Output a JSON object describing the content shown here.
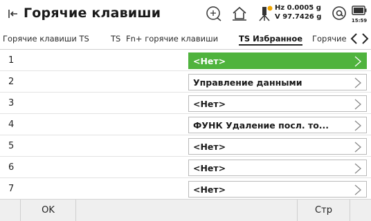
{
  "header": {
    "title": "Горячие клавиши",
    "hz": "Hz 0.0005 g",
    "v": "V  97.7426 g",
    "time": "15:59"
  },
  "tabs": [
    {
      "label": "Горячие клавиши TS"
    },
    {
      "label": "TS"
    },
    {
      "label": "Fn+ горячие клавиши"
    },
    {
      "label": "TS Избранное",
      "active": true
    },
    {
      "label": "Горячие"
    }
  ],
  "rows": [
    {
      "num": "1",
      "value": "<Нет>",
      "selected": true
    },
    {
      "num": "2",
      "value": "Управление данными",
      "selected": false
    },
    {
      "num": "3",
      "value": "<Нет>",
      "selected": false
    },
    {
      "num": "4",
      "value": "ФУНК Удаление посл. то...",
      "selected": false
    },
    {
      "num": "5",
      "value": "<Нет>",
      "selected": false
    },
    {
      "num": "6",
      "value": "<Нет>",
      "selected": false
    },
    {
      "num": "7",
      "value": "<Нет>",
      "selected": false
    }
  ],
  "footer": {
    "ok_label": "OK",
    "page_label": "Стр"
  },
  "colors": {
    "accent_green": "#4fb33d",
    "footer_bg": "#efefef"
  },
  "icons": [
    "back-icon",
    "target-icon",
    "home-icon",
    "sensor-icon",
    "at-icon",
    "battery-icon",
    "chevron-left-icon",
    "chevron-right-icon"
  ]
}
